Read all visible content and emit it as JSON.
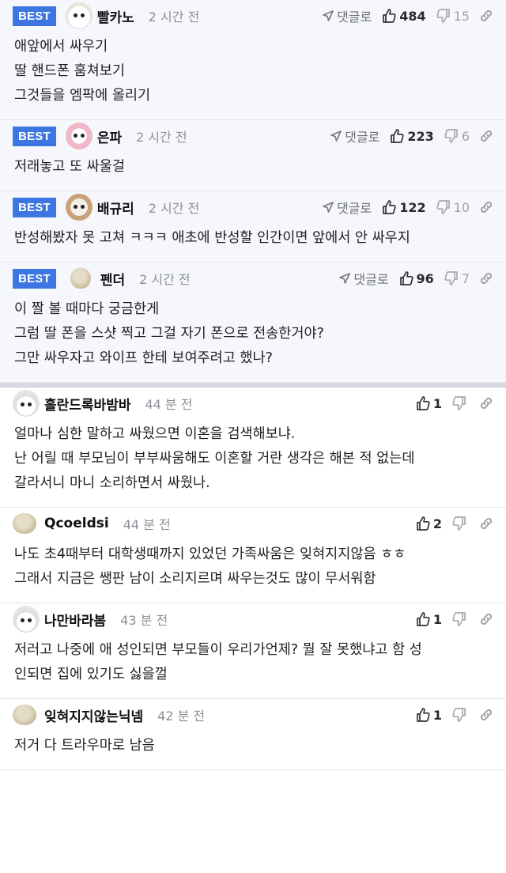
{
  "best_badge": "BEST",
  "reply_label": "댓글로",
  "best_comments": [
    {
      "nickname": "빨카노",
      "time": "2 시간 전",
      "likes": "484",
      "dislikes": "15",
      "avatar": "dog-avatar",
      "lines": [
        "애앞에서 싸우기",
        "딸 핸드폰 훔쳐보기",
        "그것들을 엠팍에 올리기"
      ]
    },
    {
      "nickname": "은파",
      "time": "2 시간 전",
      "likes": "223",
      "dislikes": "6",
      "avatar": "pink-dog-avatar",
      "lines": [
        "저래놓고 또 싸울걸"
      ]
    },
    {
      "nickname": "배규리",
      "time": "2 시간 전",
      "likes": "122",
      "dislikes": "10",
      "avatar": "puppy-avatar",
      "lines": [
        "반성해봤자 못 고쳐 ㅋㅋㅋ 애초에 반성할 인간이면 앞에서 안 싸우지"
      ]
    },
    {
      "nickname": "펜더",
      "time": "2 시간 전",
      "likes": "96",
      "dislikes": "7",
      "avatar": "blob-avatar",
      "lines": [
        "이 짤 볼 때마다 궁금한게",
        "그럼 딸 폰을 스샷 찍고 그걸 자기 폰으로 전송한거야?",
        "그만 싸우자고 와이프 한테 보여주려고 했나?"
      ]
    }
  ],
  "comments": [
    {
      "nickname": "홀란드록바밤바",
      "time": "44 분 전",
      "likes": "1",
      "avatar": "fennec-avatar",
      "lines": [
        "얼마나 심한 말하고 싸웠으면 이혼을 검색해보냐.",
        "난 어릴 때 부모님이 부부싸움해도 이혼할 거란 생각은 해본 적 없는데",
        "갈라서니 마니 소리하면서 싸웠나."
      ]
    },
    {
      "nickname": "Qcoeldsi",
      "time": "44 분 전",
      "likes": "2",
      "avatar": "blob-avatar",
      "lines": [
        "나도 초4때부터 대학생때까지 있었던 가족싸움은 잊혀지지않음 ㅎㅎ",
        "그래서 지금은 쌩판 남이 소리지르며 싸우는것도 많이 무서워함"
      ]
    },
    {
      "nickname": "나만바라봄",
      "time": "43 분 전",
      "likes": "1",
      "avatar": "fennec-avatar",
      "lines": [
        "저러고 나중에 애 성인되면 부모들이 우리가언제? 뭘 잘 못했냐고 함 성",
        "인되면 집에 있기도 싫을껄"
      ]
    },
    {
      "nickname": "잊혀지지않는닉넴",
      "time": "42 분 전",
      "likes": "1",
      "avatar": "blob-avatar",
      "lines": [
        "저거 다 트라우마로 남음"
      ]
    }
  ]
}
